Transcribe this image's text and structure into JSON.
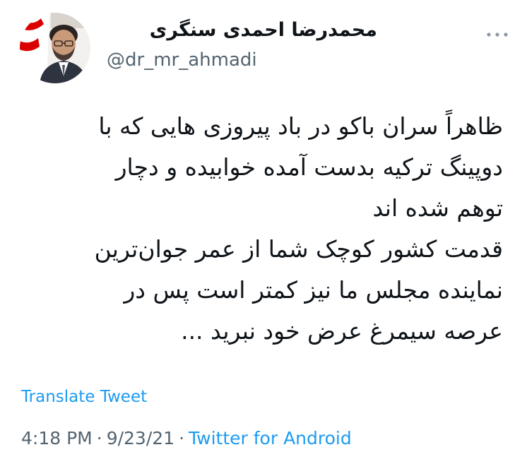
{
  "tweet": {
    "author": {
      "display_name": "محمدرضا احمدی سنگری",
      "handle": "@dr_mr_ahmadi",
      "avatar_icon": "profile-photo"
    },
    "more_icon": "more-horizontal-icon",
    "text_lines": [
      "ظاهراً سران باکو در باد پیروزی هایی که با",
      "دوپینگ ترکیه بدست آمده خوابیده و دچار",
      "توهم شده اند",
      "قدمت کشور کوچک شما از عمر جوان‌ترین",
      "نماینده مجلس ما نیز کمتر است پس در",
      "عرصه سیمرغ عرض خود نبرید ..."
    ],
    "translate_label": "Translate Tweet",
    "time": "4:18 PM",
    "date": "9/23/21",
    "separator": "·",
    "source": "Twitter for Android"
  },
  "colors": {
    "text": "#0f1419",
    "secondary": "#536471",
    "link": "#1d9bf0",
    "flag_green": "#239f40",
    "flag_red": "#da0000"
  }
}
